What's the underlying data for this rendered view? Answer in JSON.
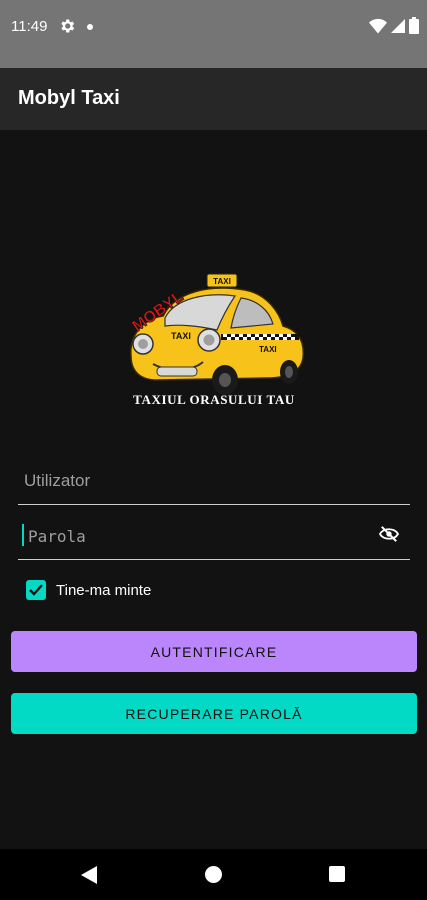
{
  "status_bar": {
    "time": "11:49",
    "icons": [
      "gear-icon",
      "notification-dot-icon",
      "wifi-icon",
      "signal-icon",
      "battery-icon"
    ]
  },
  "app_bar": {
    "title": "Mobyl Taxi"
  },
  "logo": {
    "brand_text": "MOBYL",
    "roof_sign": "TAXI",
    "door_text": "TAXI",
    "slogan": "TAXIUL ORASULUI TAU",
    "car_color": "#f7c21a"
  },
  "form": {
    "username_placeholder": "Utilizator",
    "username_value": "",
    "password_placeholder": "Parola",
    "password_value": "",
    "remember_me_label": "Tine-ma minte",
    "remember_me_checked": true
  },
  "buttons": {
    "login_label": "AUTENTIFICARE",
    "recover_label": "RECUPERARE PAROLĂ"
  },
  "colors": {
    "primary": "#bb86fc",
    "secondary": "#03dac5",
    "background": "#121212"
  },
  "nav_bar": {
    "icons": [
      "back-icon",
      "home-icon",
      "recents-icon"
    ]
  }
}
